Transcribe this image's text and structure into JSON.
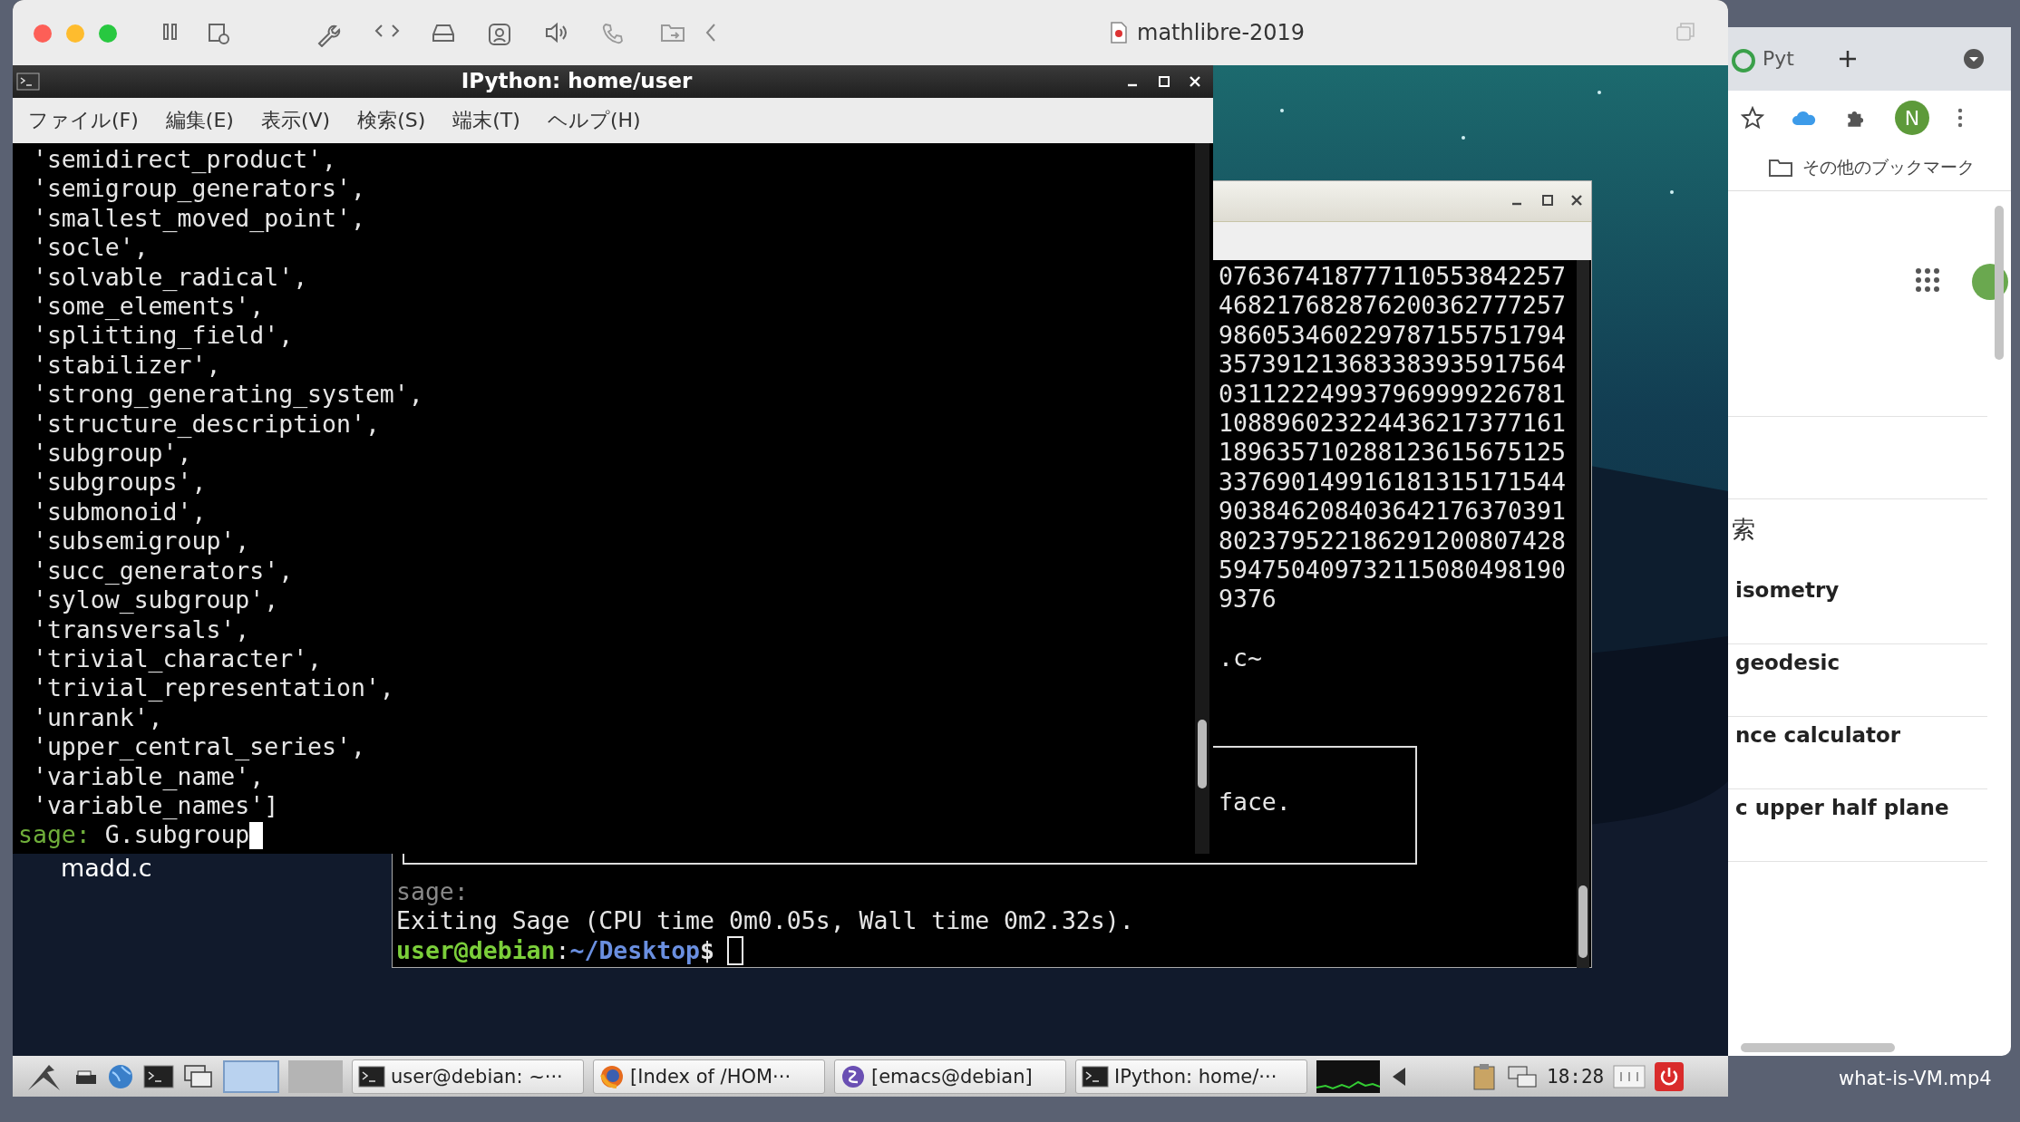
{
  "host_window": {
    "title": "mathlibre-2019"
  },
  "ipython_window": {
    "title": "IPython: home/user",
    "menu": [
      "ファイル(F)",
      "編集(E)",
      "表示(V)",
      "検索(S)",
      "端末(T)",
      "ヘルプ(H)"
    ],
    "lines": [
      " 'semidirect_product',",
      " 'semigroup_generators',",
      " 'smallest_moved_point',",
      " 'socle',",
      " 'solvable_radical',",
      " 'some_elements',",
      " 'splitting_field',",
      " 'stabilizer',",
      " 'strong_generating_system',",
      " 'structure_description',",
      " 'subgroup',",
      " 'subgroups',",
      " 'submonoid',",
      " 'subsemigroup',",
      " 'succ_generators',",
      " 'sylow_subgroup',",
      " 'transversals',",
      " 'trivial_character',",
      " 'trivial_representation',",
      " 'unrank',",
      " 'upper_central_series',",
      " 'variable_name',",
      " 'variable_names']"
    ],
    "prompt": "sage:",
    "input": "G.subgroup"
  },
  "back_terminal": {
    "number_lines": [
      "076367418777110553842257",
      "468217682876200362777257",
      "986053460229787155751794",
      "357391213683383935917564",
      "031122249937969999226781",
      "108896023224436217377161",
      "189635710288123615675125",
      "337690149916181315171544",
      "903846208403642176370391",
      "802379522186291200807428",
      "594750409732115080498190",
      "9376"
    ],
    "file_line": ".c~",
    "box_text": "face.",
    "sage_prompt": "sage:",
    "exit_line": "Exiting Sage (CPU time 0m0.05s, Wall time 0m2.32s).",
    "shell_user": "user@debian",
    "shell_sep": ":",
    "shell_path": "~/Desktop",
    "shell_sign": "$"
  },
  "desktop_files": [
    "madd.c"
  ],
  "taskbar": {
    "tasks": [
      {
        "label": "user@debian: ~···",
        "kind": "terminal"
      },
      {
        "label": "[Index of /HOM···",
        "kind": "firefox"
      },
      {
        "label": "[emacs@debian]",
        "kind": "emacs"
      },
      {
        "label": "IPython: home/···",
        "kind": "terminal"
      }
    ],
    "clock": "18:28"
  },
  "browser": {
    "tab": "Pyt",
    "avatar": "N",
    "bookmarks": "その他のブックマーク",
    "search_label": "索",
    "results": [
      "isometry",
      "geodesic",
      "nce calculator",
      "c upper half plane"
    ]
  },
  "desktop_label": "what-is-VM.mp4"
}
